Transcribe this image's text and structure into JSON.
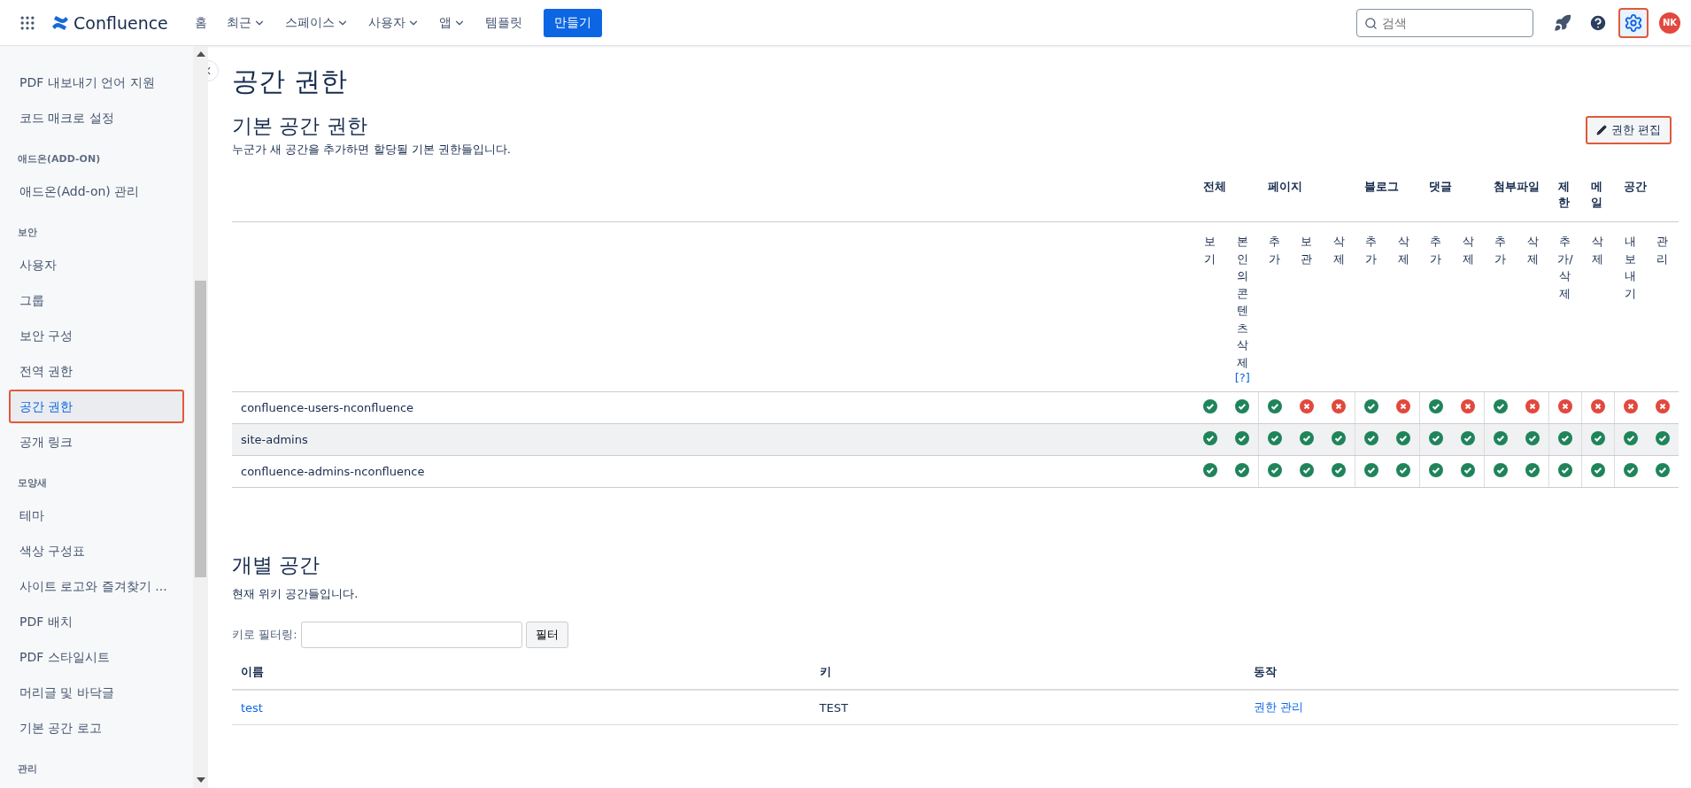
{
  "topbar": {
    "logo": "Confluence",
    "nav": [
      {
        "label": "홈",
        "dropdown": false
      },
      {
        "label": "최근",
        "dropdown": true
      },
      {
        "label": "스페이스",
        "dropdown": true
      },
      {
        "label": "사용자",
        "dropdown": true
      },
      {
        "label": "앱",
        "dropdown": true
      },
      {
        "label": "템플릿",
        "dropdown": false
      }
    ],
    "create_button": "만들기",
    "search": {
      "placeholder": "검색"
    },
    "settings": {
      "selected": true,
      "highlighted": true
    },
    "avatar": "NK"
  },
  "sidebar": {
    "items": [
      {
        "kind": "item",
        "label": "PDF 내보내기 언어 지원",
        "selected": false,
        "highlighted": false
      },
      {
        "kind": "item",
        "label": "코드 매크로 설정",
        "selected": false,
        "highlighted": false
      },
      {
        "kind": "header",
        "label": "애드온(ADD-ON)"
      },
      {
        "kind": "item",
        "label": "애드온(Add-on) 관리",
        "selected": false,
        "highlighted": false
      },
      {
        "kind": "header",
        "label": "보안"
      },
      {
        "kind": "item",
        "label": "사용자",
        "selected": false,
        "highlighted": false
      },
      {
        "kind": "item",
        "label": "그룹",
        "selected": false,
        "highlighted": false
      },
      {
        "kind": "item",
        "label": "보안 구성",
        "selected": false,
        "highlighted": false
      },
      {
        "kind": "item",
        "label": "전역 권한",
        "selected": false,
        "highlighted": false
      },
      {
        "kind": "item",
        "label": "공간 권한",
        "selected": true,
        "highlighted": true
      },
      {
        "kind": "item",
        "label": "공개 링크",
        "selected": false,
        "highlighted": false
      },
      {
        "kind": "header",
        "label": "모양새"
      },
      {
        "kind": "item",
        "label": "테마",
        "selected": false,
        "highlighted": false
      },
      {
        "kind": "item",
        "label": "색상 구성표",
        "selected": false,
        "highlighted": false
      },
      {
        "kind": "item",
        "label": "사이트 로고와 즐겨찾기 ...",
        "selected": false,
        "highlighted": false
      },
      {
        "kind": "item",
        "label": "PDF 배치",
        "selected": false,
        "highlighted": false
      },
      {
        "kind": "item",
        "label": "PDF 스타일시트",
        "selected": false,
        "highlighted": false
      },
      {
        "kind": "item",
        "label": "머리글 및 바닥글",
        "selected": false,
        "highlighted": false
      },
      {
        "kind": "item",
        "label": "기본 공간 로고",
        "selected": false,
        "highlighted": false
      },
      {
        "kind": "header",
        "label": "관리"
      }
    ]
  },
  "page_title": "공간 권한",
  "default_permissions": {
    "title": "기본 공간 권한",
    "description": "누군가 새 공간을 추가하면 할당될 기본 권한들입니다.",
    "edit_button": {
      "label": "권한 편집",
      "highlighted": true
    },
    "groups": [
      {
        "label": "전체",
        "columns": [
          {
            "label": "보기"
          },
          {
            "label": "본인의콘텐츠삭제",
            "help": "[?]"
          }
        ]
      },
      {
        "label": "페이지",
        "columns": [
          {
            "label": "추가"
          },
          {
            "label": "보관"
          },
          {
            "label": "삭제"
          }
        ]
      },
      {
        "label": "블로그",
        "columns": [
          {
            "label": "추가"
          },
          {
            "label": "삭제"
          }
        ]
      },
      {
        "label": "댓글",
        "columns": [
          {
            "label": "추가"
          },
          {
            "label": "삭제"
          }
        ]
      },
      {
        "label": "첨부파일",
        "columns": [
          {
            "label": "추가"
          },
          {
            "label": "삭제"
          }
        ]
      },
      {
        "label": "제한",
        "columns": [
          {
            "label": "추가/삭제"
          }
        ]
      },
      {
        "label": "메일",
        "columns": [
          {
            "label": "삭제"
          }
        ]
      },
      {
        "label": "공간",
        "columns": [
          {
            "label": "내보내기"
          },
          {
            "label": "관리"
          }
        ]
      }
    ],
    "rows": [
      {
        "name": "confluence-users-nconfluence",
        "selected": false,
        "granted": [
          true,
          true,
          true,
          false,
          false,
          true,
          false,
          true,
          false,
          true,
          false,
          false,
          false,
          false,
          false
        ]
      },
      {
        "name": "site-admins",
        "selected": true,
        "granted": [
          true,
          true,
          true,
          true,
          true,
          true,
          true,
          true,
          true,
          true,
          true,
          true,
          true,
          true,
          true
        ]
      },
      {
        "name": "confluence-admins-nconfluence",
        "selected": false,
        "granted": [
          true,
          true,
          true,
          true,
          true,
          true,
          true,
          true,
          true,
          true,
          true,
          true,
          true,
          true,
          true
        ]
      }
    ]
  },
  "individual_spaces": {
    "title": "개별 공간",
    "description": "현재 위키 공간들입니다.",
    "filter": {
      "label": "키로 필터링:",
      "button": "필터"
    },
    "columns": [
      "이름",
      "키",
      "동작"
    ],
    "rows": [
      {
        "name": "test",
        "key": "TEST",
        "action": "권한 관리"
      }
    ]
  }
}
